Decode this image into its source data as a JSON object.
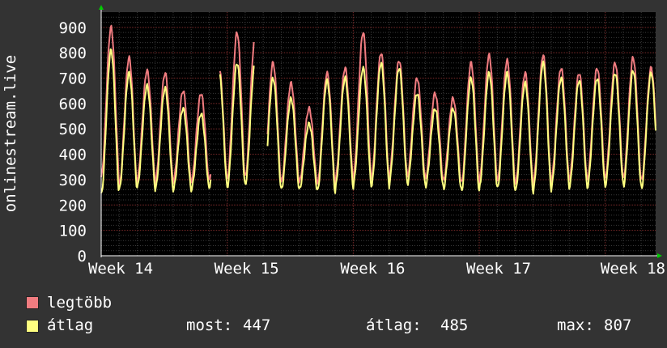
{
  "chart_data": {
    "type": "line",
    "ylabel": "onlinestream.live",
    "ylim": [
      0,
      960
    ],
    "yticks": [
      0,
      100,
      200,
      300,
      400,
      500,
      600,
      700,
      800,
      900
    ],
    "xticks": [
      "Week 14",
      "Week 15",
      "Week 16",
      "Week 17",
      "Week 18"
    ],
    "x_range_days": [
      0,
      30.8
    ],
    "grid": true,
    "series": [
      {
        "name": "legtöbb",
        "color": "#f07c80",
        "description": "daily maximum listeners, daily cycle",
        "peaks": [
          900,
          780,
          730,
          720,
          650,
          640,
          740,
          880,
          860,
          760,
          680,
          580,
          720,
          740,
          880,
          800,
          770,
          700,
          640,
          620,
          760,
          790,
          770,
          720,
          790,
          740,
          720,
          740,
          760,
          780,
          740,
          650
        ],
        "troughs": [
          310,
          270,
          300,
          290,
          290,
          290,
          300,
          300,
          310,
          290,
          290,
          290,
          280,
          300,
          310,
          300,
          320,
          310,
          300,
          290,
          280,
          300,
          290,
          280,
          290,
          300,
          300,
          300,
          310,
          300,
          290,
          300
        ]
      },
      {
        "name": "átlag",
        "color": "#ffff80",
        "description": "average listeners, daily cycle",
        "peaks": [
          810,
          720,
          670,
          660,
          580,
          560,
          720,
          760,
          760,
          700,
          620,
          520,
          690,
          700,
          740,
          760,
          740,
          640,
          580,
          580,
          700,
          720,
          720,
          680,
          760,
          700,
          690,
          700,
          720,
          730,
          720,
          600
        ],
        "troughs": [
          240,
          260,
          270,
          260,
          260,
          260,
          270,
          270,
          280,
          260,
          260,
          260,
          250,
          270,
          280,
          270,
          290,
          280,
          270,
          260,
          250,
          270,
          260,
          250,
          260,
          270,
          270,
          270,
          280,
          270,
          260,
          440
        ]
      }
    ],
    "gaps": [
      [
        6.1,
        6.6
      ],
      [
        8.5,
        9.2
      ]
    ]
  },
  "legend": {
    "items": [
      {
        "label": "legtöbb",
        "color": "#f07c80"
      },
      {
        "label": "átlag",
        "color": "#ffff80"
      }
    ],
    "stats": [
      {
        "label": "most:",
        "value": "447"
      },
      {
        "label": "átlag:",
        "value": "485"
      },
      {
        "label": "max:",
        "value": "807"
      }
    ]
  }
}
